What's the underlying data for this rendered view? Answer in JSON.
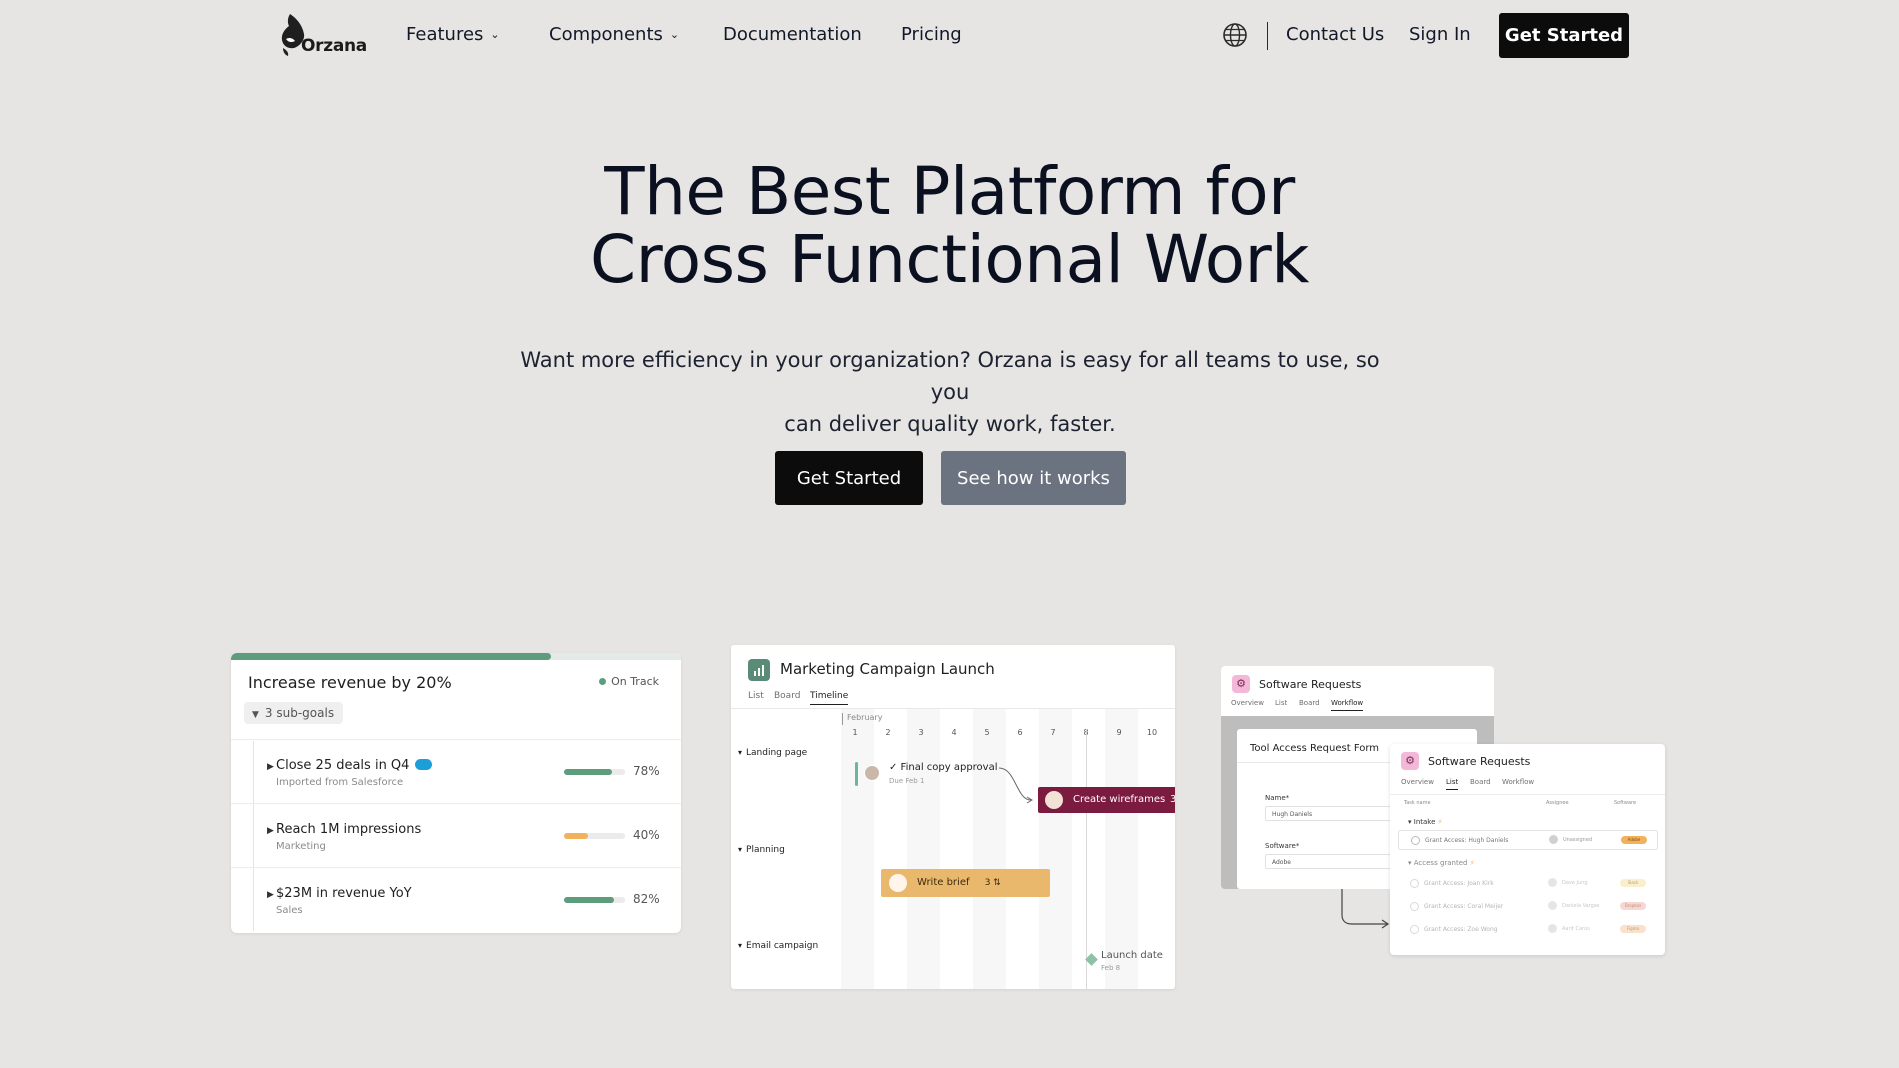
{
  "nav": {
    "logo_text": "Orzana",
    "features_label": "Features",
    "components_label": "Components",
    "documentation_label": "Documentation",
    "pricing_label": "Pricing",
    "contact_label": "Contact Us",
    "signin_label": "Sign In",
    "cta_label": "Get Started",
    "chevron": "⌄"
  },
  "hero": {
    "title_line1": "The Best Platform for",
    "title_line2": "Cross Functional Work",
    "subtitle_line1": "Want more efficiency in your organization? Orzana is easy for all teams to use, so you",
    "subtitle_line2": "can deliver quality work, faster.",
    "primary_button": "Get Started",
    "secondary_button": "See how it works"
  },
  "goals_card": {
    "title": "Increase revenue by 20%",
    "overall_progress": 0.71,
    "status": "On Track",
    "subgoals": "3 sub-goals",
    "items": [
      {
        "name": "Close 25 deals in Q4",
        "meta": "Imported from Salesforce",
        "pct": "78%",
        "value": 0.78,
        "color": "#5d9c7d"
      },
      {
        "name": "Reach 1M impressions",
        "meta": "Marketing",
        "pct": "40%",
        "value": 0.4,
        "color": "#f2b25c"
      },
      {
        "name": "$23M in revenue YoY",
        "meta": "Sales",
        "pct": "82%",
        "value": 0.82,
        "color": "#5d9c7d"
      }
    ]
  },
  "timeline_card": {
    "title": "Marketing Campaign Launch",
    "tabs": [
      "List",
      "Board",
      "Timeline"
    ],
    "month": "February",
    "days": [
      "1",
      "2",
      "3",
      "4",
      "5",
      "6",
      "7",
      "8",
      "9",
      "10"
    ],
    "sections": [
      "Landing page",
      "Planning",
      "Email campaign"
    ],
    "task_final": "✓ Final copy approval",
    "task_final_due": "Due Feb 1",
    "task_wireframes": "Create wireframes",
    "task_wireframes_more": "3",
    "task_brief": "Write brief",
    "task_brief_count": "3 ⇅",
    "milestone": "Launch date",
    "milestone_date": "Feb 8"
  },
  "workflow_card": {
    "back_title": "Software Requests",
    "back_tabs": [
      "Overview",
      "List",
      "Board",
      "Workflow"
    ],
    "form_title": "Tool Access Request Form",
    "name_label": "Name*",
    "name_value": "Hugh Daniels",
    "software_label": "Software*",
    "software_value": "Adobe",
    "front_title": "Software Requests",
    "front_tabs": [
      "Overview",
      "List",
      "Board",
      "Workflow"
    ],
    "col_task": "Task name",
    "col_assignee": "Assignee",
    "col_software": "Software",
    "section_intake": "Intake",
    "section_granted": "Access granted",
    "rows": [
      {
        "task": "Grant Access: Hugh Daniels",
        "assignee": "Unassigned",
        "tag": "Adobe",
        "tag_color": "#f2b25c"
      },
      {
        "task": "Grant Access: Joan Kirk",
        "assignee": "Dave Jung",
        "tag": "Slack",
        "tag_color": "#f7e3a3"
      },
      {
        "task": "Grant Access: Coral Meijer",
        "assignee": "Daniela Vargas",
        "tag": "Dropbox",
        "tag_color": "#f6b3b3"
      },
      {
        "task": "Grant Access: Zoe Wong",
        "assignee": "Aarit Carus",
        "tag": "Figma",
        "tag_color": "#f6c9a3"
      }
    ]
  },
  "colors": {
    "background": "#e6e5e3",
    "primary_button": "#0c0c0c",
    "secondary_button": "#6b7280",
    "goal_green": "#5d9c7d",
    "goal_orange": "#f2b25c",
    "wireframes_bar": "#7b1b40",
    "brief_bar": "#e9b86c"
  }
}
